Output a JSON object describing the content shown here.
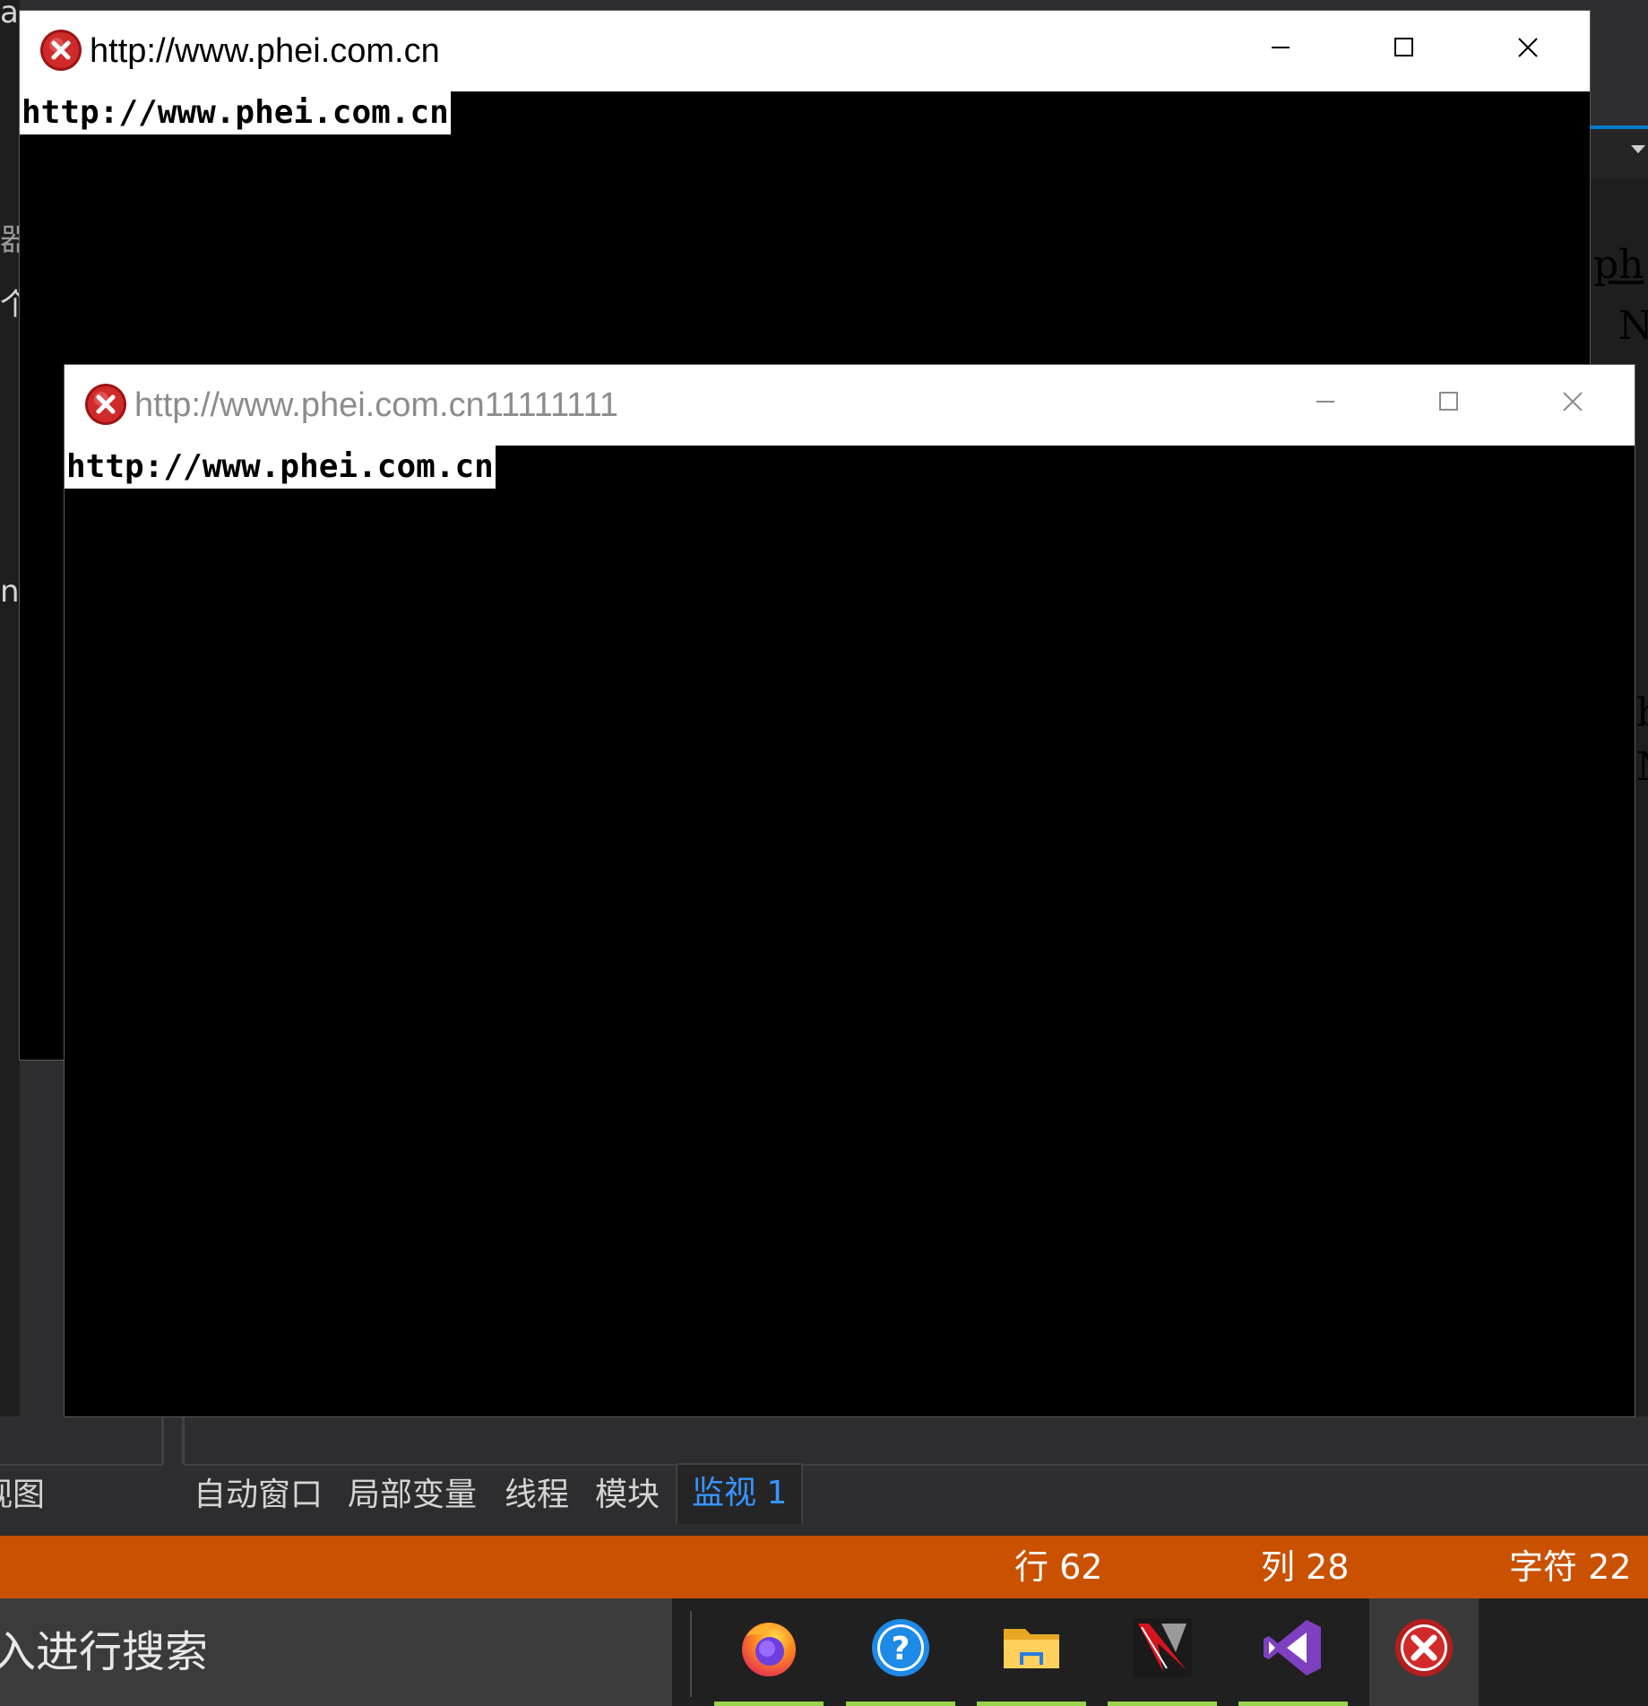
{
  "colors": {
    "status_bar": "#ca5100",
    "active_tab_text": "#3794ff",
    "taskbar_underline": "#99d34a",
    "console_bg": "#000000",
    "titlebar_bg": "#ffffff"
  },
  "ide": {
    "left_fragments": [
      "ai",
      "器(",
      "个",
      "n."
    ],
    "right_code": [
      {
        "text": "ph",
        "color": "#569cd6"
      },
      {
        "text": "NU",
        "color": "#c586c0"
      },
      {
        "text": "b",
        "color": "#569cd6"
      },
      {
        "text": "NU",
        "color": "#c586c0"
      }
    ],
    "panel_left_label": "视图",
    "tabs": [
      {
        "label": "自动窗口"
      },
      {
        "label": "局部变量"
      },
      {
        "label": "线程"
      },
      {
        "label": "模块"
      },
      {
        "label": "监视 1",
        "active": true
      }
    ]
  },
  "statusbar": {
    "line": "行 62",
    "col": "列 28",
    "char": "字符 22"
  },
  "taskbar": {
    "search_text": "入进行搜索",
    "apps": [
      {
        "name": "firefox",
        "icon": "firefox-icon"
      },
      {
        "name": "help",
        "icon": "help-icon"
      },
      {
        "name": "file-explorer",
        "icon": "folder-icon"
      },
      {
        "name": "app-red",
        "icon": "app-icon"
      },
      {
        "name": "visual-studio",
        "icon": "visual-studio-icon"
      },
      {
        "name": "error-window",
        "icon": "error-icon",
        "active": true
      }
    ]
  },
  "windows": [
    {
      "title": "http://www.phei.com.cn",
      "console_text": "http://www.phei.com.cn",
      "icon": "error-icon",
      "active": true
    },
    {
      "title": "http://www.phei.com.cn11111111",
      "console_text": "http://www.phei.com.cn",
      "icon": "error-icon",
      "active": false
    }
  ]
}
